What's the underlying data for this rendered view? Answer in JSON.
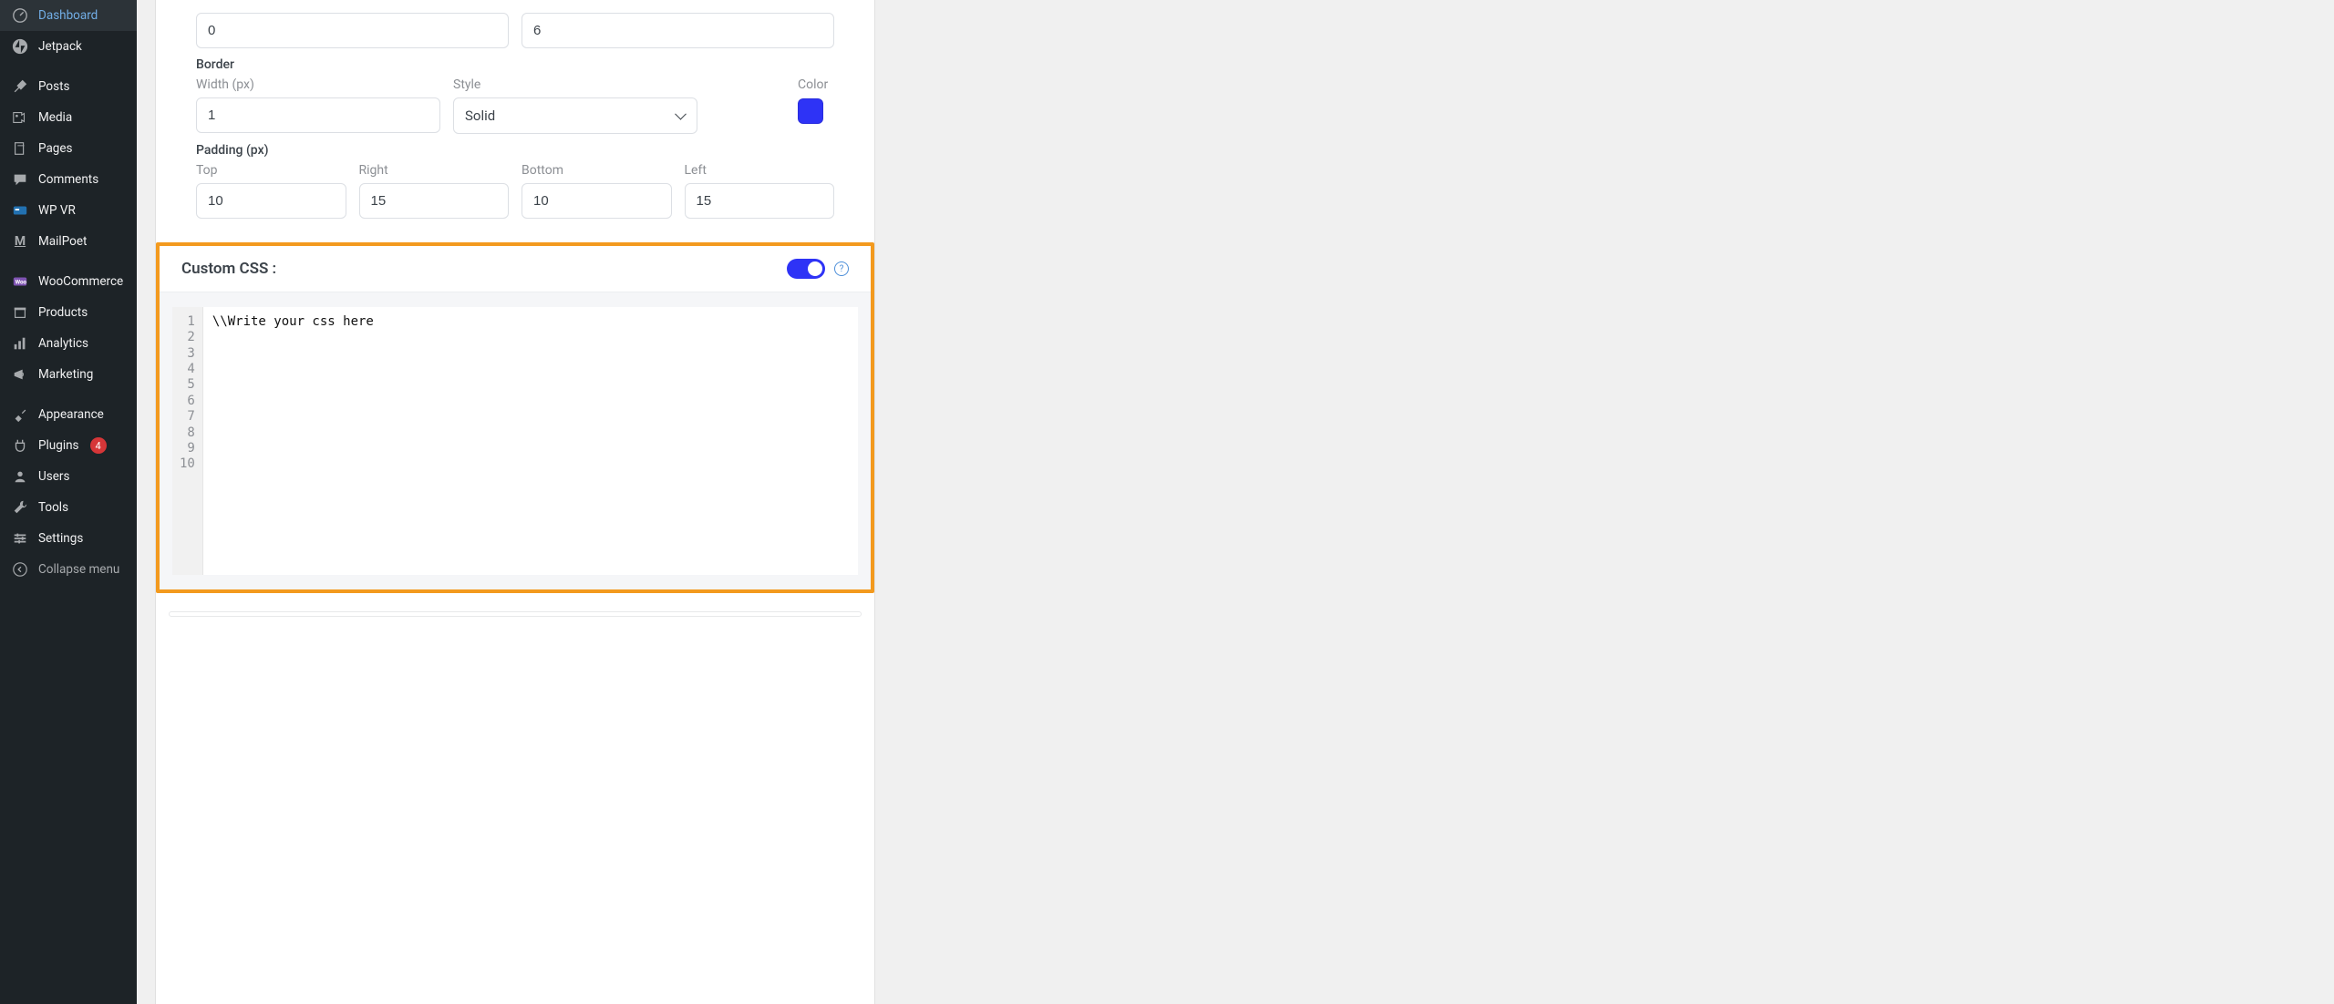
{
  "sidebar": {
    "items": [
      {
        "label": "Dashboard"
      },
      {
        "label": "Jetpack"
      },
      {
        "label": "Posts"
      },
      {
        "label": "Media"
      },
      {
        "label": "Pages"
      },
      {
        "label": "Comments"
      },
      {
        "label": "WP VR"
      },
      {
        "label": "MailPoet"
      },
      {
        "label": "WooCommerce"
      },
      {
        "label": "Products"
      },
      {
        "label": "Analytics"
      },
      {
        "label": "Marketing"
      },
      {
        "label": "Appearance"
      },
      {
        "label": "Plugins"
      },
      {
        "label": "Users"
      },
      {
        "label": "Tools"
      },
      {
        "label": "Settings"
      },
      {
        "label": "Collapse menu"
      }
    ],
    "plugins_badge": "4"
  },
  "form": {
    "topinputs": {
      "left": "0",
      "right": "6"
    },
    "border": {
      "heading": "Border",
      "width_label": "Width (px)",
      "width_value": "1",
      "style_label": "Style",
      "style_value": "Solid",
      "color_label": "Color",
      "color_value": "#2e33f6"
    },
    "padding": {
      "heading": "Padding (px)",
      "top_label": "Top",
      "top_value": "10",
      "right_label": "Right",
      "right_value": "15",
      "bottom_label": "Bottom",
      "bottom_value": "10",
      "left_label": "Left",
      "left_value": "15"
    },
    "custom_css": {
      "title": "Custom CSS :",
      "content": "\\\\Write your css here",
      "lines": [
        "1",
        "2",
        "3",
        "4",
        "5",
        "6",
        "7",
        "8",
        "9",
        "10"
      ]
    }
  }
}
